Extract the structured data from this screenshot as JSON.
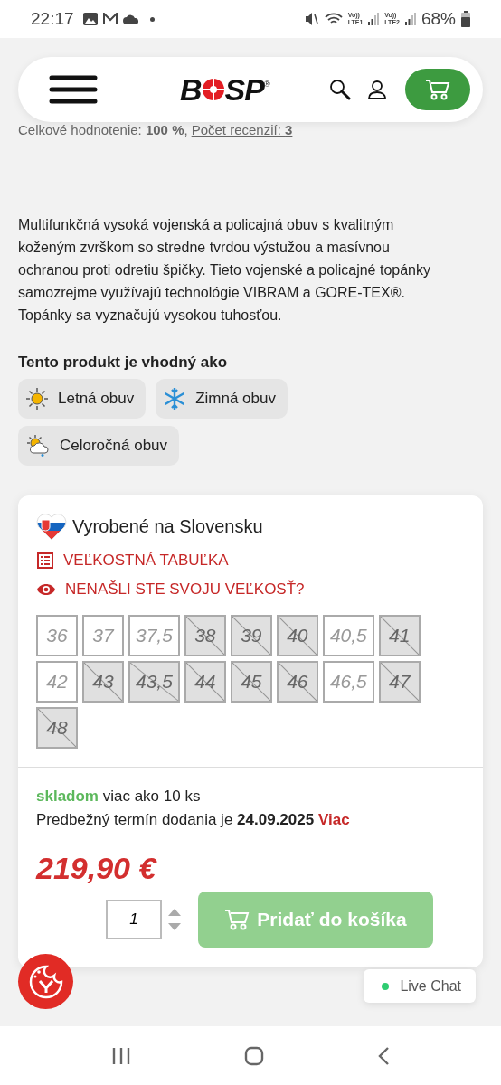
{
  "status_bar": {
    "time": "22:17",
    "sims": [
      {
        "top": "Vo))",
        "bottom": "LTE1"
      },
      {
        "top": "Vo))",
        "bottom": "LTE2"
      }
    ],
    "battery": "68%"
  },
  "header": {
    "logo": {
      "left": "B",
      "right": "SP",
      "mark": "®"
    }
  },
  "rating": {
    "label": "Celkové hodnotenie: **100 %**,",
    "link": "Počet recenzií: **3**"
  },
  "description": "Multifunkčná vysoká vojenská a policajná obuv s kvalitným koženým zvrškom so stredne tvrdou výstužou a masívnou ochranou proti odretiu špičky. Tieto vojenské a policajné topánky samozrejme využívajú technológie VIBRAM a GORE-TEX®. Topánky sa vyznačujú vysokou tuhosťou.",
  "suitable": {
    "title": "Tento produkt je vhodný ako",
    "chips": [
      {
        "kind": "sun",
        "label": "Letná obuv"
      },
      {
        "kind": "snow",
        "label": "Zimná obuv"
      },
      {
        "kind": "cloud",
        "label": "Celoročná obuv"
      }
    ]
  },
  "card": {
    "made_in": "Vyrobené na Slovensku",
    "links": [
      {
        "kind": "table",
        "label": "VEĽKOSTNÁ TABUĽKA"
      },
      {
        "kind": "eye",
        "label": "NENAŠLI STE SVOJU VEĽKOSŤ?"
      }
    ],
    "sizes": [
      {
        "label": "36",
        "available": true
      },
      {
        "label": "37",
        "available": true
      },
      {
        "label": "37,5",
        "available": true
      },
      {
        "label": "38",
        "available": false
      },
      {
        "label": "39",
        "available": false
      },
      {
        "label": "40",
        "available": false
      },
      {
        "label": "40,5",
        "available": true
      },
      {
        "label": "41",
        "available": false
      },
      {
        "label": "42",
        "available": true
      },
      {
        "label": "43",
        "available": false
      },
      {
        "label": "43,5",
        "available": false
      },
      {
        "label": "44",
        "available": false
      },
      {
        "label": "45",
        "available": false
      },
      {
        "label": "46",
        "available": false
      },
      {
        "label": "46,5",
        "available": true
      },
      {
        "label": "47",
        "available": false
      },
      {
        "label": "48",
        "available": false
      }
    ],
    "stock": {
      "status": "skladom",
      "text": "viac ako 10 ks"
    },
    "delivery": {
      "text": "Predbežný termín dodania je **24.09.2025**",
      "link": "Viac"
    },
    "price": "219,90 €",
    "quantity": "1",
    "add_button": "Pridať do košíka"
  },
  "live_chat": {
    "label": "Live Chat",
    "color": "#2ecc71"
  }
}
